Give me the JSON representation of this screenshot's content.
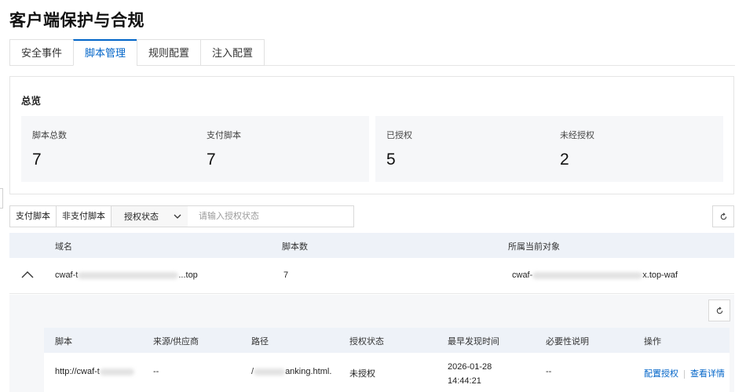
{
  "page": {
    "title": "客户端保护与合规"
  },
  "tabs": [
    {
      "label": "安全事件"
    },
    {
      "label": "脚本管理"
    },
    {
      "label": "规则配置"
    },
    {
      "label": "注入配置"
    }
  ],
  "overview": {
    "title": "总览",
    "stats": [
      {
        "label": "脚本总数",
        "value": "7"
      },
      {
        "label": "支付脚本",
        "value": "7"
      },
      {
        "label": "已授权",
        "value": "5"
      },
      {
        "label": "未经授权",
        "value": "2"
      }
    ]
  },
  "filters": {
    "payment_btn": "支付脚本",
    "non_payment_btn": "非支付脚本",
    "select_label": "授权状态",
    "search_placeholder": "请输入授权状态"
  },
  "main_table": {
    "columns": [
      "域名",
      "脚本数",
      "所属当前对象"
    ],
    "row": {
      "domain_prefix": "cwaf-t",
      "domain_suffix": "...top",
      "count": "7",
      "object_prefix": "cwaf-",
      "object_suffix": "x.top-waf"
    }
  },
  "sub_table": {
    "columns": [
      "脚本",
      "来源/供应商",
      "路径",
      "授权状态",
      "最早发现时间",
      "必要性说明",
      "操作"
    ],
    "row": {
      "script_prefix": "http://cwaf-t",
      "source": "--",
      "path_prefix": "/",
      "path_suffix": "anking.html.",
      "auth_status": "未授权",
      "first_seen_date": "2026-01-28",
      "first_seen_time": "14:44:21",
      "necessity": "--",
      "action_config": "配置授权",
      "action_detail": "查看详情"
    }
  },
  "icons": {
    "refresh": "refresh-icon",
    "expand": "chevron-up-icon",
    "select": "chevron-down-icon"
  },
  "colors": {
    "accent": "#0064c8",
    "header_bg": "#eef2f8",
    "panel_bg": "#f6f7f9"
  }
}
